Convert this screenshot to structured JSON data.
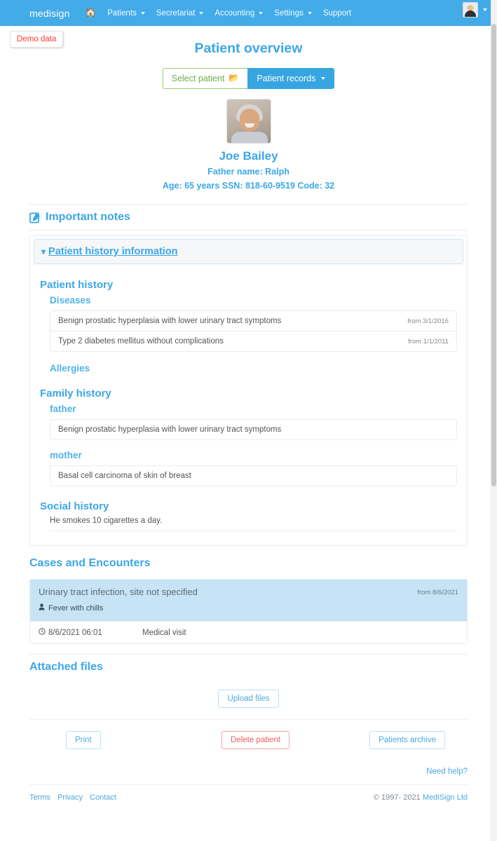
{
  "navbar": {
    "brand": "medisign",
    "home_icon": "home-icon",
    "items": [
      {
        "label": "Patients",
        "has_caret": true
      },
      {
        "label": "Secretariat",
        "has_caret": true
      },
      {
        "label": "Accounting",
        "has_caret": true
      },
      {
        "label": "Settings",
        "has_caret": true
      },
      {
        "label": "Support",
        "has_caret": false
      }
    ],
    "avatar_icon": "user-avatar-icon",
    "bg_color": "#42abe8"
  },
  "demo_badge": {
    "label": "Demo data",
    "color": "#ff3b30"
  },
  "page": {
    "title": "Patient overview",
    "accent": "#3ba7e8"
  },
  "toolbar": {
    "select_patient_label": "Select patient",
    "select_patient_icon": "folder-open-icon",
    "patient_records_label": "Patient records"
  },
  "patient": {
    "photo_icon": "patient-photo",
    "name": "Joe Bailey",
    "father_name_line": "Father name: Ralph",
    "details_line": "Age: 65 years SSN: 818-60-9519 Code: 32"
  },
  "important_notes": {
    "label": "Important notes",
    "icon": "edit-square-icon"
  },
  "history_panel": {
    "toggle_label": "Patient history information",
    "chevron_icon": "chevron-down-icon",
    "patient_history_title": "Patient history",
    "diseases_title": "Diseases",
    "diseases": [
      {
        "name": "Benign prostatic hyperplasia with lower urinary tract symptoms",
        "from": "from 3/1/2016"
      },
      {
        "name": "Type 2 diabetes mellitus without complications",
        "from": "from 1/1/2011"
      }
    ],
    "allergies_title": "Allergies",
    "family_history_title": "Family history",
    "family": [
      {
        "relation": "father",
        "entries": [
          "Benign prostatic hyperplasia with lower urinary tract symptoms"
        ]
      },
      {
        "relation": "mother",
        "entries": [
          "Basal cell carcinoma of skin of breast"
        ]
      }
    ],
    "social_history_title": "Social history",
    "social_history_text": "He smokes 10 cigarettes a day."
  },
  "cases": {
    "title": "Cases and Encounters",
    "case": {
      "title": "Urinary tract infection, site not specified",
      "from": "from 8/6/2021",
      "symptom_icon": "person-icon",
      "symptom": "Fever with chills"
    },
    "visit": {
      "clock_icon": "clock-icon",
      "datetime": "8/6/2021 06:01",
      "type": "Medical visit"
    }
  },
  "attached_files": {
    "title": "Attached files",
    "upload_label": "Upload files"
  },
  "actions": {
    "print_label": "Print",
    "delete_label": "Delete patient",
    "archive_label": "Patients archive",
    "need_help_label": "Need help?"
  },
  "footer": {
    "links": [
      "Terms",
      "Privacy",
      "Contact"
    ],
    "copyright": "© 1997- 2021 ",
    "company": "MediSign Ltd"
  }
}
